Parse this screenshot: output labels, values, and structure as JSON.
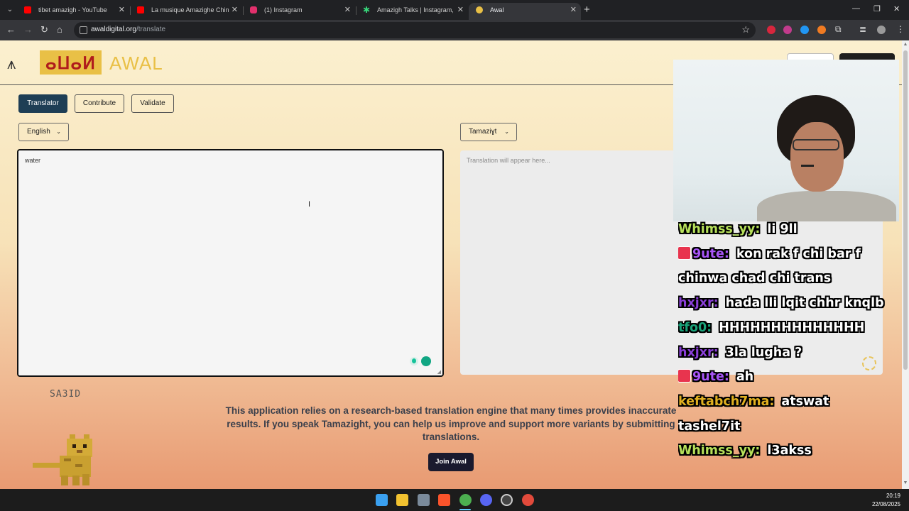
{
  "browser": {
    "tabs": [
      {
        "title": "tibet amazigh - YouTube",
        "icon": "youtube-icon",
        "color": "#ff0000"
      },
      {
        "title": "La musique Amazighe Chinoise",
        "icon": "youtube-icon",
        "color": "#ff0000"
      },
      {
        "title": "(1) Instagram",
        "icon": "instagram-icon",
        "color": "#e1306c"
      },
      {
        "title": "Amazigh Talks | Instagram, Face",
        "icon": "asterisk-icon",
        "color": "#37d67a"
      },
      {
        "title": "Awal",
        "icon": "awal-icon",
        "color": "#e9c046",
        "active": true
      }
    ],
    "url_domain": "awaldigital.org",
    "url_path": "/translate"
  },
  "page": {
    "brand": {
      "tifinagh": "ⴰⵡⴰⵍ",
      "name": "AWAL"
    },
    "modes": [
      "Translator",
      "Contribute",
      "Validate"
    ],
    "source_language": "English",
    "target_language": "Tamaziɣt",
    "source_text": "water",
    "target_placeholder": "Translation will appear here...",
    "mascot_name": "SA3ID",
    "notice": "This application relies on a research-based translation engine that many times provides inaccurate results. If you speak Tamazight, you can help us improve and support more variants by submitting translations.",
    "join_button": "Join Awal"
  },
  "chat": [
    {
      "user": "Whimss_yy:",
      "color": "#b6e05a",
      "text": "li 9ll"
    },
    {
      "user": "9ute:",
      "color": "#a855f7",
      "badge": true,
      "text": "kon rak f chi bar f chinwa chad chi trans"
    },
    {
      "user": "hxjxr:",
      "color": "#8b3fd9",
      "text": "hada lli lqit chhr knqlb"
    },
    {
      "user": "tfo0:",
      "color": "#1aa37a",
      "text": "HHHHHHHHHHHHHH"
    },
    {
      "user": "hxjxr:",
      "color": "#8b3fd9",
      "text": "3la lugha ?"
    },
    {
      "user": "9ute:",
      "color": "#a855f7",
      "badge": true,
      "text": "ah"
    },
    {
      "user": "keftabch7ma:",
      "color": "#e0b020",
      "text": "atswat tashel7it"
    },
    {
      "user": "Whimss_yy:",
      "color": "#b6e05a",
      "text": "l3akss"
    }
  ],
  "taskbar": {
    "apps": [
      {
        "icon": "windows-start-icon",
        "color": "#3aa0f0"
      },
      {
        "icon": "file-explorer-icon",
        "color": "#f2c230"
      },
      {
        "icon": "davinci-resolve-icon",
        "color": "#7a8a9a"
      },
      {
        "icon": "brave-icon",
        "color": "#fb542b"
      },
      {
        "icon": "chrome-icon",
        "color": "#4caf50"
      },
      {
        "icon": "discord-icon",
        "color": "#5865f2"
      },
      {
        "icon": "obs-icon",
        "color": "#cccccc"
      },
      {
        "icon": "chrome-alt-icon",
        "color": "#e24a3b"
      }
    ],
    "time": "20:19",
    "date": "22/08/2025"
  }
}
